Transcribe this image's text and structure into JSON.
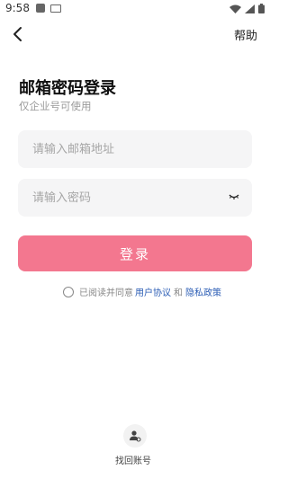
{
  "status_bar": {
    "time": "9:58"
  },
  "header": {
    "help_label": "帮助"
  },
  "title": "邮箱密码登录",
  "subtitle": "仅企业号可使用",
  "email_field": {
    "value": "",
    "placeholder": "请输入邮箱地址"
  },
  "password_field": {
    "value": "",
    "placeholder": "请输入密码"
  },
  "login_button": "登录",
  "agreement": {
    "prefix": "已阅读并同意",
    "user_agreement": "用户协议",
    "and": "和",
    "privacy_policy": "隐私政策"
  },
  "recover_account": "找回账号",
  "colors": {
    "accent": "#f3778f",
    "link": "#2b5db5",
    "field_bg": "#f5f5f6"
  },
  "icons": [
    "back-arrow-icon",
    "eye-closed-icon",
    "radio-icon",
    "user-recover-icon",
    "wifi-icon",
    "signal-icon",
    "battery-icon"
  ]
}
